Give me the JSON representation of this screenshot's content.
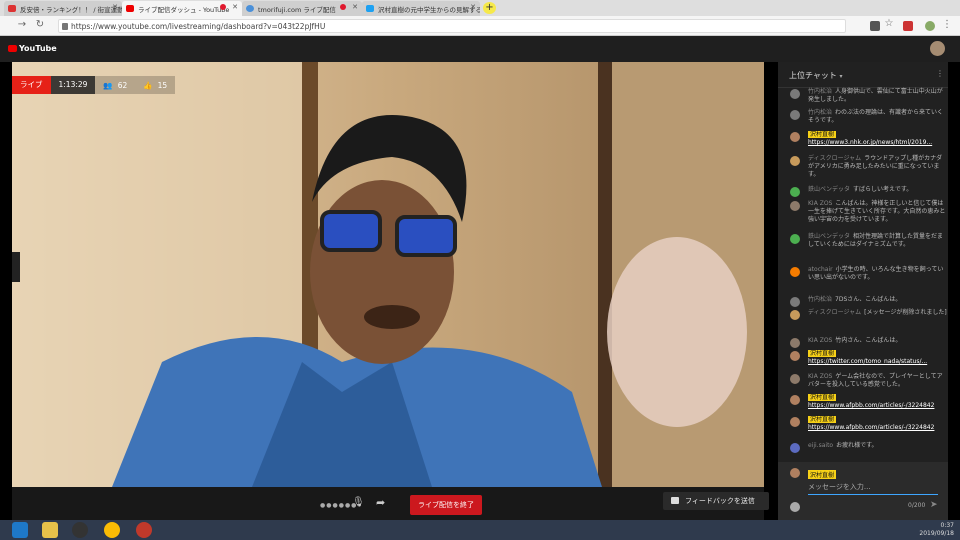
{
  "browser": {
    "tabs": [
      {
        "label": "反安倍・ランキング！！ / 街宣運動をヒ"
      },
      {
        "label": "ライブ配信ダッシュ - YouTube"
      },
      {
        "label": "tmorifuji.com ライブ配信"
      },
      {
        "label": "沢村直樹の元中学生からの見解する市"
      }
    ],
    "url": "https://www.youtube.com/livestreaming/dashboard?v=043t22pJfHU",
    "new_tab_label": "+"
  },
  "youtube": {
    "logo": "YouTube"
  },
  "video": {
    "live_label": "ライブ",
    "elapsed": "1:13:29",
    "viewers": "62",
    "likes": "15",
    "end_stream_label": "ライブ配信を終了",
    "feedback_label": "フィードバックを送信"
  },
  "chat": {
    "header": "上位チャット",
    "messages": [
      {
        "author": "竹内松治",
        "text": "人身御供山で、雲仙にて富士山中火山が発生しました。",
        "color": "#7a7a7a"
      },
      {
        "author": "竹内松治",
        "text": "わのぶ法の理論は、有識者から来ていくそうです。",
        "color": "#7a7a7a"
      },
      {
        "owner": "沢村直樹",
        "text": "https://www3.nhk.or.jp/news/html/2019...",
        "link": true,
        "color": "#b08060"
      },
      {
        "author": "ディスクロージャム",
        "text": "ラウンドアップし種がカナダがアメリカに勇み足したみたいに重になっています。",
        "color": "#c79a5b"
      },
      {
        "author": "鉄山ベンデッタ",
        "text": "すばらしい考えです。",
        "color": "#4caf50"
      },
      {
        "author": "KIA ZOS",
        "text": "こんばんは。神様を正しいと信じて僕は一生を捧げて生きていく所存です。大自然の恵みと強い宇宙の力を受けています。",
        "color": "#8d7a6a"
      },
      {
        "author": "鉄山ベンデッタ",
        "text": "相対性理論で計算した質量をだましていくためにはダイナミズムです。",
        "color": "#4caf50"
      },
      {
        "author": "atochair",
        "text": "小学生の時、いろんな生き物を飼っていい思い出がないのです。",
        "color": "#f57c00"
      },
      {
        "author": "竹内松治",
        "text": "7DSさん、こんばんは。",
        "color": "#7a7a7a"
      },
      {
        "author": "ディスクロージャム",
        "text": "[メッセージが削除されました]",
        "color": "#c79a5b"
      },
      {
        "author": "KIA ZOS",
        "text": "竹内さん、こんばんは。",
        "color": "#8d7a6a"
      },
      {
        "owner": "沢村直樹",
        "text": "https://twitter.com/tomo_nada/status/...",
        "link": true,
        "color": "#b08060"
      },
      {
        "author": "KIA ZOS",
        "text": "ゲーム会社なので、プレイヤーとしてアバターを投入している感覚でした。",
        "color": "#8d7a6a"
      },
      {
        "owner": "沢村直樹",
        "text": "https://www.afpbb.com/articles/-/3224842",
        "link": true,
        "color": "#b08060"
      },
      {
        "owner": "沢村直樹",
        "text": "https://www.afpbb.com/articles/-/3224842",
        "link": true,
        "color": "#b08060"
      },
      {
        "author": "eiji.saito",
        "text": "お疲れ様です。",
        "color": "#5c6bc0"
      }
    ],
    "input_owner": "沢村直樹",
    "input_placeholder": "メッセージを入力...",
    "char_count": "0/200"
  },
  "taskbar": {
    "time": "0:37",
    "date": "2019/09/18"
  }
}
